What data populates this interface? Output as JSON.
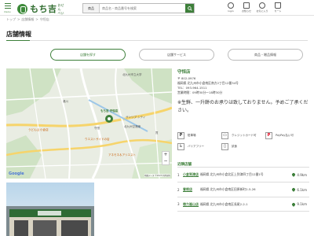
{
  "header": {
    "menu_label": "menu",
    "logo_text": "もち吉",
    "logo_sub": "おせん べい",
    "search": {
      "category": "商品",
      "placeholder": "商品名・商品番号を検索"
    },
    "icons": [
      {
        "name": "login-icon",
        "label": "login"
      },
      {
        "name": "notice-icon",
        "label": "お知らせ"
      },
      {
        "name": "favorite-icon",
        "label": "お気に入り"
      },
      {
        "name": "cart-icon",
        "label": "カート"
      }
    ]
  },
  "breadcrumb": [
    "トップ",
    "店舗情報",
    "守恒店"
  ],
  "page_title": "店舗情報",
  "tabs": [
    {
      "label": "店舗を探す",
      "active": true
    },
    {
      "label": "店舗サービス",
      "active": false
    },
    {
      "label": "商品・贈品情報",
      "active": false
    }
  ],
  "map": {
    "labels": [
      {
        "text": "もち吉 守恒店",
        "color": "#3d7f3a"
      },
      {
        "text": "北九州市立大学",
        "color": "#555"
      },
      {
        "text": "うどん山 小倉店",
        "color": "#c85a00"
      },
      {
        "text": "守恒",
        "color": "#555"
      },
      {
        "text": "湯川",
        "color": "#555"
      },
      {
        "text": "ウエストサイドの店",
        "color": "#c85a00"
      },
      {
        "text": "アネモネ＆アリエスト",
        "color": "#c85a00"
      },
      {
        "text": "サンリブ シティ",
        "color": "#555"
      },
      {
        "text": "北九州空港線",
        "color": "#555"
      },
      {
        "text": "貫",
        "color": "#555"
      }
    ],
    "google": "Google",
    "attribution": "地図データ ©2023 利用規約",
    "zoom_in": "+",
    "zoom_out": "−"
  },
  "store": {
    "name": "守恒店",
    "zip": "〒 802-0976",
    "address": "福岡県 北九州市小倉南区南方2丁目12番34号",
    "tel": "TEL：093-964-1511",
    "hours": "営業時間：09時30分～18時30分",
    "holiday": "定休日：元日・1月2日・年末年始（不定休）",
    "notice": "※生鮮、一升餅のお承りは致しておりません。予めご了承ください。"
  },
  "services": [
    {
      "icon": "P",
      "label": "駐車場"
    },
    {
      "icon": "▭",
      "label": "クレジットカード可"
    },
    {
      "icon": "P",
      "label": "PayPay払い可"
    },
    {
      "icon": "♿",
      "label": "バリアフリー"
    },
    {
      "icon": "▯",
      "label": "試食"
    }
  ],
  "nearby": {
    "title": "近隣店舗",
    "rows": [
      {
        "num": "1",
        "name": "小倉到津店",
        "address": "福岡県 北九州市小倉北区上到津四丁目12番1号",
        "distance": "4.9km"
      },
      {
        "num": "2",
        "name": "曽根店",
        "address": "福岡県 北九州市小倉南区田原新町2-5-26",
        "distance": "6.1km"
      },
      {
        "num": "3",
        "name": "徳力嵐山店",
        "address": "福岡県 北九州市小倉南区長尾2-2-1",
        "distance": "9.1km"
      }
    ]
  },
  "colors": {
    "brand": "#3d7f3a",
    "accent_orange": "#c85a00"
  }
}
